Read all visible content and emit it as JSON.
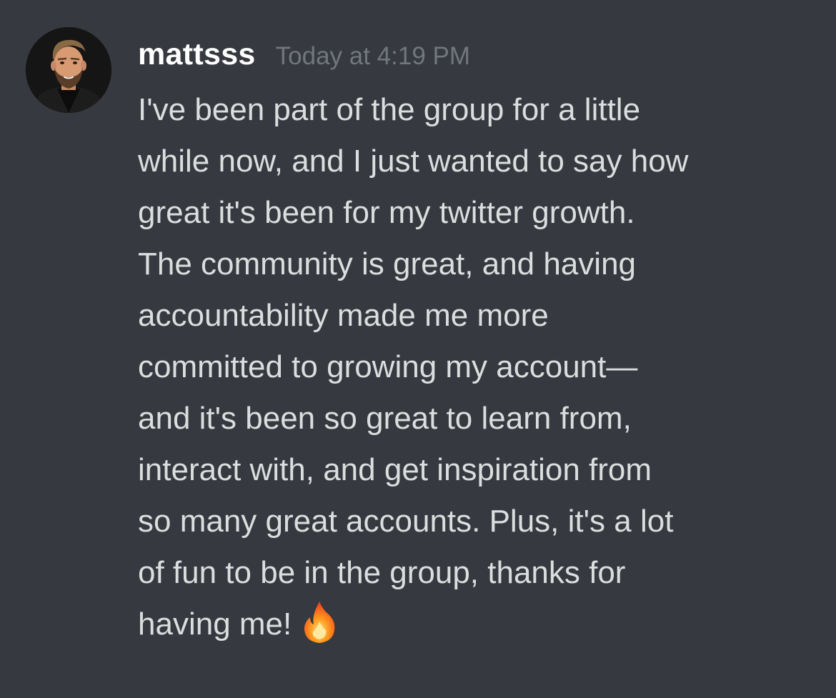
{
  "message": {
    "author": "mattsss",
    "timestamp": "Today at 4:19 PM",
    "avatar_icon": "user-avatar-icon",
    "lines": [
      "I've been part of the group for a little",
      "while now, and I just wanted to say how",
      "great it's been for my twitter growth.",
      "The community is great, and having",
      "accountability made me more",
      "committed to growing my account—",
      "and it's been so great to learn from,",
      "interact with, and get inspiration from",
      "so many great accounts. Plus, it's a lot",
      "of fun to be in the group, thanks for",
      "having me!"
    ],
    "emoji": "fire-emoji-icon"
  },
  "colors": {
    "background": "#36393f",
    "username": "#ffffff",
    "timestamp": "#72767d",
    "text": "#dcddde"
  }
}
